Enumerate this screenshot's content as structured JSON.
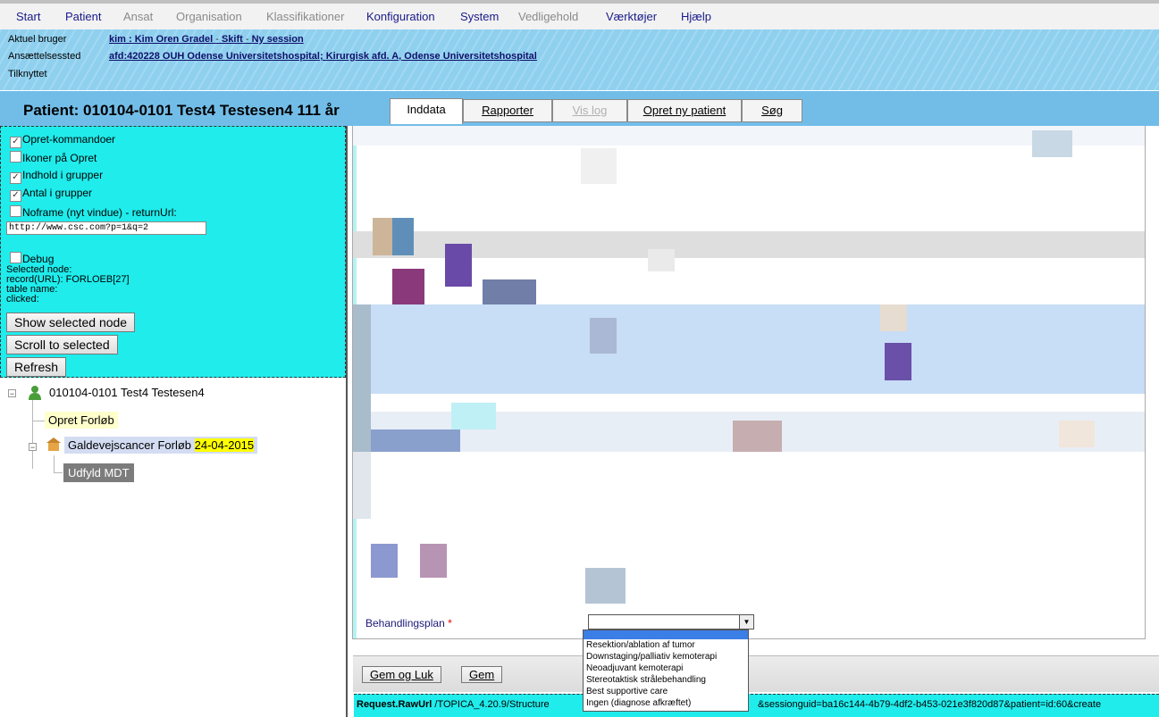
{
  "menu": [
    {
      "label": "Start",
      "enabled": true
    },
    {
      "label": "Patient",
      "enabled": true
    },
    {
      "label": "Ansat",
      "enabled": false
    },
    {
      "label": "Organisation",
      "enabled": false
    },
    {
      "label": "Klassifikationer",
      "enabled": false
    },
    {
      "label": "Konfiguration",
      "enabled": true
    },
    {
      "label": "System",
      "enabled": true
    },
    {
      "label": "Vedligehold",
      "enabled": false
    },
    {
      "label": "Værktøjer",
      "enabled": true
    },
    {
      "label": "Hjælp",
      "enabled": true
    }
  ],
  "info": {
    "user_label": "Aktuel bruger",
    "user_value": "kim : Kim Oren Gradel",
    "switch": "Skift",
    "new_session": "Ny session",
    "sep": "-",
    "employment_label": "Ansættelsessted",
    "employment_value": "afd:420228 OUH Odense Universitetshospital; Kirurgisk afd. A, Odense Universitetshospital",
    "attached_label": "Tilknyttet"
  },
  "patient": {
    "title": "Patient: 010104-0101 Test4 Testesen4 111 år"
  },
  "tabs": [
    {
      "label": "Inddata",
      "active": true,
      "enabled": true
    },
    {
      "label": "Rapporter",
      "active": false,
      "enabled": true
    },
    {
      "label": "Vis log",
      "active": false,
      "enabled": false
    },
    {
      "label": "Opret ny patient",
      "active": false,
      "enabled": true
    },
    {
      "label": "Søg",
      "active": false,
      "enabled": true
    }
  ],
  "options": {
    "opret_kommandoer": {
      "label": "Opret-kommandoer",
      "checked": true
    },
    "ikoner": {
      "label": "Ikoner på Opret",
      "checked": false
    },
    "indhold": {
      "label": "Indhold i grupper",
      "checked": true
    },
    "antal": {
      "label": "Antal i grupper",
      "checked": true
    },
    "noframe": {
      "label": "Noframe (nyt vindue) - returnUrl:",
      "checked": false
    },
    "return_url": "http://www.csc.com?p=1&q=2",
    "debug": {
      "label": "Debug",
      "checked": false
    }
  },
  "debug_info": {
    "selected_node": "Selected node:",
    "record": "record(URL): FORLOEB[27]",
    "table_name": "table name:",
    "clicked": "clicked:"
  },
  "buttons": {
    "show_selected": "Show selected node",
    "scroll_selected": "Scroll to selected",
    "refresh": "Refresh"
  },
  "tree": {
    "root": "010104-0101 Test4 Testesen4",
    "opret_forloeb": "Opret Forløb",
    "forloeb": "Galdevejscancer Forløb",
    "forloeb_date": "24-04-2015",
    "udfyld": "Udfyld MDT"
  },
  "form": {
    "behandlingsplan_label": "Behandlingsplan",
    "required_mark": "*",
    "dropdown_options": [
      "Resektion/ablation af tumor",
      "Downstaging/palliativ kemoterapi",
      "Neoadjuvant kemoterapi",
      "Stereotaktisk strålebehandling",
      "Best supportive care",
      "Ingen (diagnose afkræftet)"
    ]
  },
  "bottom": {
    "save_close": "Gem og Luk",
    "save": "Gem"
  },
  "request": {
    "label": "Request.RawUrl",
    "url": " /TOPICA_4.20.9/Structure",
    "url_tail": "&sessionguid=ba16c144-4b79-4df2-b453-021e3f820d87&patient=id:60&create"
  },
  "colors": {
    "accent_cyan": "#20ecec",
    "patient_bar": "#72bde8",
    "info_band": "#8fd0ef",
    "date_highlight": "#ffff00",
    "dropdown_selected": "#3b7ee6"
  }
}
